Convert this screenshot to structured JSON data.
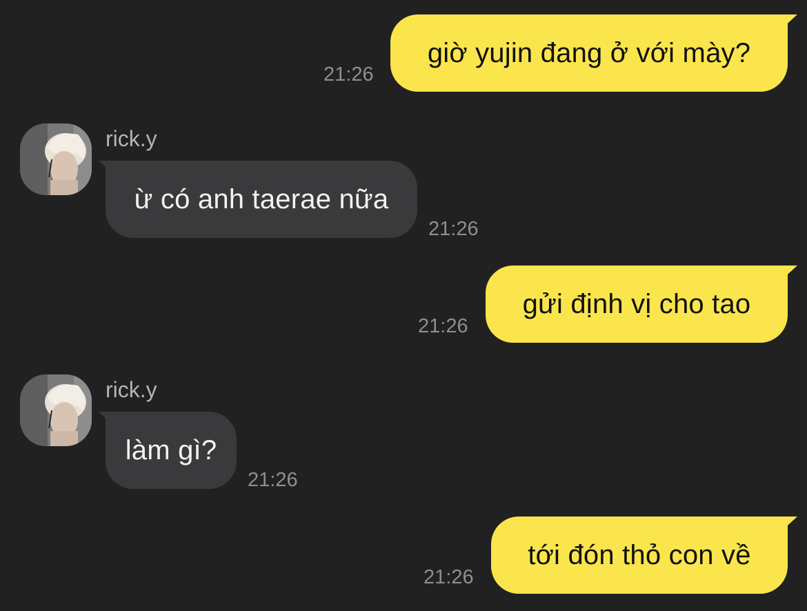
{
  "conversation": {
    "messages": [
      {
        "direction": "sent",
        "text": "giờ yujin đang ở với mày?",
        "time": "21:26"
      },
      {
        "direction": "received",
        "sender": "rick.y",
        "text": "ừ có anh taerae nữa",
        "time": "21:26"
      },
      {
        "direction": "sent",
        "text": "gửi định vị cho tao",
        "time": "21:26"
      },
      {
        "direction": "received",
        "sender": "rick.y",
        "text": "làm gì?",
        "time": "21:26"
      },
      {
        "direction": "sent",
        "text": "tới đón thỏ con về",
        "time": "21:26"
      }
    ]
  },
  "colors": {
    "background": "#212121",
    "sent_bubble": "#fbe54c",
    "received_bubble": "#3a3a3c",
    "timestamp": "#8e8e93"
  },
  "icons": {
    "avatar": "contact-avatar-photo"
  }
}
